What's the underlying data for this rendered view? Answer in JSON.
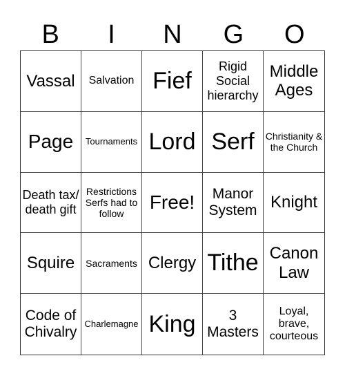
{
  "header": {
    "letters": [
      "B",
      "I",
      "N",
      "G",
      "O"
    ]
  },
  "board": {
    "cells": [
      "Vassal",
      "Salvation",
      "Fief",
      "Rigid Social hierarchy",
      "Middle Ages",
      "Page",
      "Tournaments",
      "Lord",
      "Serf",
      "Christianity & the Church",
      "Death tax/ death gift",
      "Restrictions Serfs had to follow",
      "Free!",
      "Manor System",
      "Knight",
      "Squire",
      "Sacraments",
      "Clergy",
      "Tithe",
      "Canon Law",
      "Code of Chivalry",
      "Charlemagne",
      "King",
      "3 Masters",
      "Loyal, brave, courteous"
    ]
  }
}
